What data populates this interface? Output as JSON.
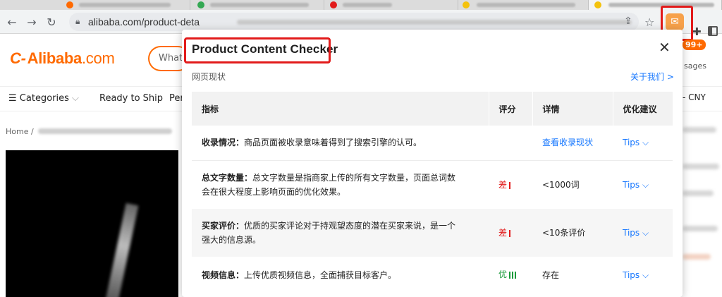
{
  "browser": {
    "url": "alibaba.com/product-deta"
  },
  "site": {
    "logo_name": "Alibaba",
    "logo_suffix": ".com",
    "search_placeholder": "What",
    "messages_badge": "99+",
    "messages_label": "sages",
    "categories_label": "Categories",
    "nav_ready_to_ship": "Ready to Ship",
    "nav_partial": "Per",
    "currency": "CNY",
    "breadcrumb_home": "Home",
    "breadcrumb_sep": "/"
  },
  "popup": {
    "title": "Product Content Checker",
    "section_label": "网页现状",
    "about_link": "关于我们 >",
    "columns": [
      "指标",
      "评分",
      "详情",
      "优化建议"
    ],
    "rows": [
      {
        "name": "收录情况：",
        "desc": "商品页面被收录意味着得到了搜索引擎的认可。",
        "score": "",
        "score_level": "none",
        "bars": 0,
        "detail": "查看收录现状",
        "detail_is_link": true,
        "tips": "Tips"
      },
      {
        "name": "总文字数量：",
        "desc": "总文字数量是指商家上传的所有文字数量，页面总词数会在很大程度上影响页面的优化效果。",
        "score": "差",
        "score_level": "bad",
        "bars": 1,
        "detail": "<1000词",
        "detail_is_link": false,
        "tips": "Tips"
      },
      {
        "name": "买家评价：",
        "desc": "优质的买家评论对于持观望态度的潜在买家来说，是一个强大的信息源。",
        "score": "差",
        "score_level": "bad",
        "bars": 1,
        "detail": "<10条评价",
        "detail_is_link": false,
        "tips": "Tips"
      },
      {
        "name": "视频信息：",
        "desc": "上传优质视频信息，全面捕获目标客户。",
        "score": "优",
        "score_level": "good",
        "bars": 3,
        "detail": "存在",
        "detail_is_link": false,
        "tips": "Tips"
      }
    ]
  },
  "colors": {
    "brand_orange": "#ff6a00",
    "link_blue": "#1677ff",
    "bad_red": "#e21b1b",
    "good_green": "#1a9a3a",
    "highlight_red": "#e21b1b"
  },
  "icons": {
    "back": "arrow-left-icon",
    "forward": "arrow-right-icon",
    "reload": "reload-icon",
    "lock": "lock-icon",
    "share": "share-icon",
    "star": "star-icon",
    "extension": "envelope-icon",
    "extensions_menu": "puzzle-icon",
    "side_panel": "side-panel-icon",
    "close": "close-icon",
    "chevron": "chevron-down-icon"
  }
}
